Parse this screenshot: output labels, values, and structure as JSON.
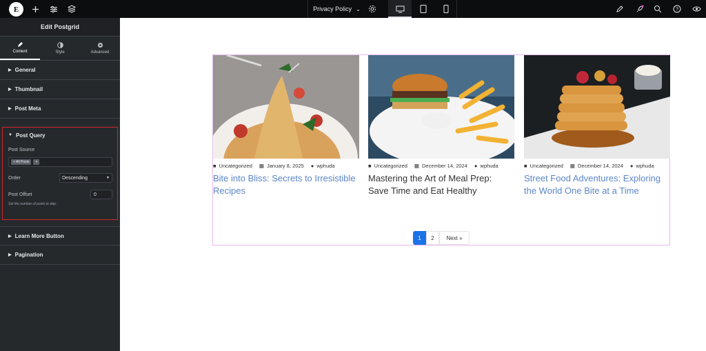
{
  "topbar": {
    "logo_letter": "E",
    "page_name": "Privacy Policy",
    "icons": [
      "add-icon",
      "sliders-icon",
      "layers-icon",
      "gear-icon",
      "desktop-icon",
      "tablet-icon",
      "mobile-icon",
      "pen-icon",
      "rocket-icon",
      "search-icon",
      "help-icon",
      "eye-icon"
    ]
  },
  "sidebar": {
    "header": "Edit Postgrid",
    "tabs": [
      {
        "label": "Content",
        "icon": "pencil-icon",
        "active": true
      },
      {
        "label": "Style",
        "icon": "contrast-icon",
        "active": false
      },
      {
        "label": "Advanced",
        "icon": "gear-icon",
        "active": false
      }
    ],
    "sections_top": [
      "General",
      "Thumbnail",
      "Post Meta"
    ],
    "post_query": {
      "title": "Post Query",
      "post_source_label": "Post Source",
      "post_source_tag": "× All Posts",
      "add_tag": "+",
      "order_label": "Order",
      "order_value": "Descending",
      "offset_label": "Post Offset",
      "offset_value": "0",
      "offset_hint": "Set the number of posts to skip."
    },
    "sections_bottom": [
      "Learn More Button",
      "Pagination"
    ]
  },
  "posts": [
    {
      "category": "Uncategorized",
      "date": "January 8, 2025",
      "author": "wphuda",
      "title": "Bite into Bliss: Secrets to Irresistible Recipes",
      "title_color": "#5a86c8"
    },
    {
      "category": "Uncategorized",
      "date": "December 14, 2024",
      "author": "wphuda",
      "title": "Mastering the Art of Meal Prep: Save Time and Eat Healthy",
      "title_color": "#333333"
    },
    {
      "category": "Uncategorized",
      "date": "December 14, 2024",
      "author": "wphuda",
      "title": "Street Food Adventures: Exploring the World One Bite at a Time",
      "title_color": "#5a86c8"
    }
  ],
  "pagination": {
    "current": "1",
    "next_page": "2",
    "next_label": "Next »"
  },
  "colors": {
    "accent": "#1a73e8",
    "link": "#5a86c8",
    "highlight": "#d3242e",
    "widget_border": "#e7b8ed"
  }
}
